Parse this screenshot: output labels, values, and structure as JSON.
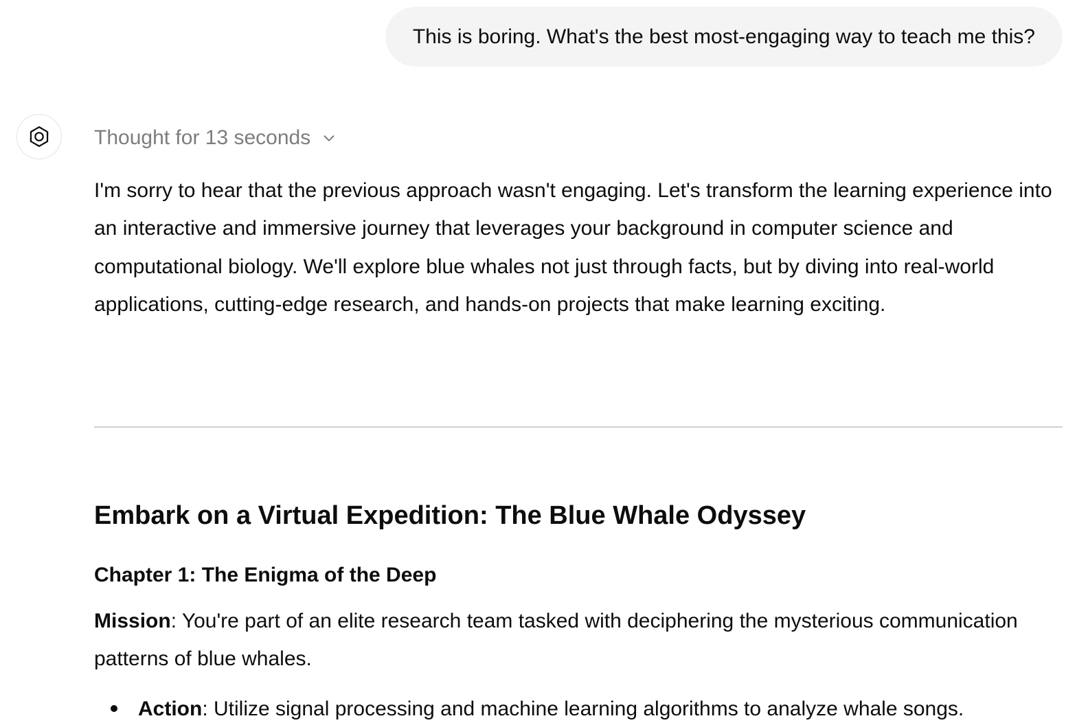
{
  "user_message": {
    "text": "This is boring. What's the best most-engaging way to teach me this?"
  },
  "assistant": {
    "avatar_icon": "openai-logo-icon",
    "thought_label": "Thought for 13 seconds",
    "intro_paragraph": "I'm sorry to hear that the previous approach wasn't engaging. Let's transform the learning experience into an interactive and immersive journey that leverages your background in computer science and computational biology. We'll explore blue whales not just through facts, but by diving into real-world applications, cutting-edge research, and hands-on projects that make learning exciting.",
    "heading": "Embark on a Virtual Expedition: The Blue Whale Odyssey",
    "chapter_title": "Chapter 1: The Enigma of the Deep",
    "mission": {
      "label": "Mission",
      "text": ": You're part of an elite research team tasked with deciphering the mysterious communication patterns of blue whales."
    },
    "bullets": [
      {
        "label": "Action",
        "text": ": Utilize signal processing and machine learning algorithms to analyze whale songs."
      }
    ]
  },
  "colors": {
    "bubble_bg": "#f4f4f4",
    "text": "#0d0d0d",
    "muted": "#7d7d7d",
    "divider": "#d0d0d0"
  }
}
